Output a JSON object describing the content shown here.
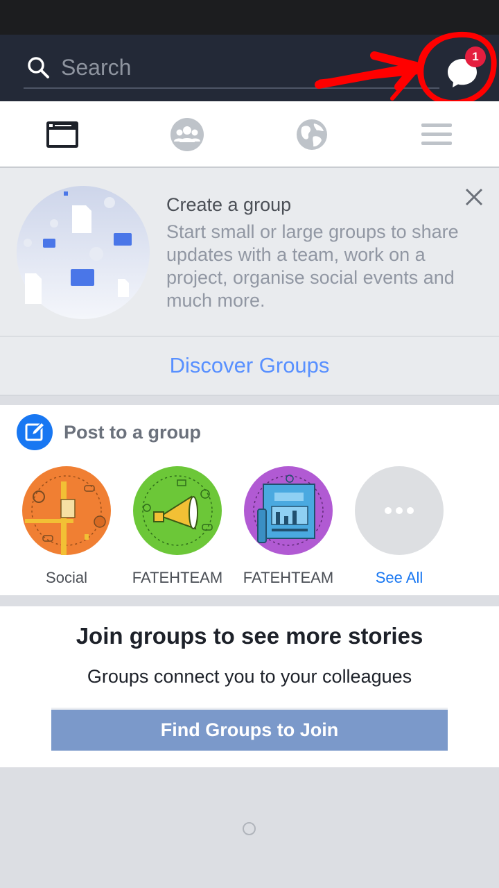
{
  "header": {
    "search_placeholder": "Search",
    "messages_badge": "1"
  },
  "tabs": [
    {
      "label": "Feed",
      "icon": "feed-icon",
      "active": true
    },
    {
      "label": "Groups",
      "icon": "people-icon",
      "active": false
    },
    {
      "label": "Discover",
      "icon": "globe-icon",
      "active": false
    },
    {
      "label": "Menu",
      "icon": "hamburger-icon",
      "active": false
    }
  ],
  "create_group": {
    "title": "Create a group",
    "description": "Start small or large groups to share updates with a team, work on a project, organise social events and much more."
  },
  "discover": {
    "label": "Discover Groups"
  },
  "post_to_group": {
    "title": "Post to a group",
    "groups": [
      {
        "label": "Social",
        "color": "#f07f33",
        "icon": "social-illustration"
      },
      {
        "label": "FATEHTEAM",
        "color": "#6cc738",
        "icon": "megaphone-illustration"
      },
      {
        "label": "FATEHTEAM",
        "color": "#b15ad3",
        "icon": "news-illustration"
      },
      {
        "label": "See All",
        "color": "#dddfe2",
        "icon": "more-dots-icon"
      }
    ]
  },
  "join": {
    "title": "Join groups to see more stories",
    "subtitle": "Groups connect you to your colleagues",
    "button_label": "Find Groups to Join"
  },
  "colors": {
    "topbar": "#232937",
    "accent_blue": "#1877f2",
    "link_blue": "#5890ff",
    "badge_red": "#e41e3f",
    "annotation_red": "#ff0000"
  }
}
